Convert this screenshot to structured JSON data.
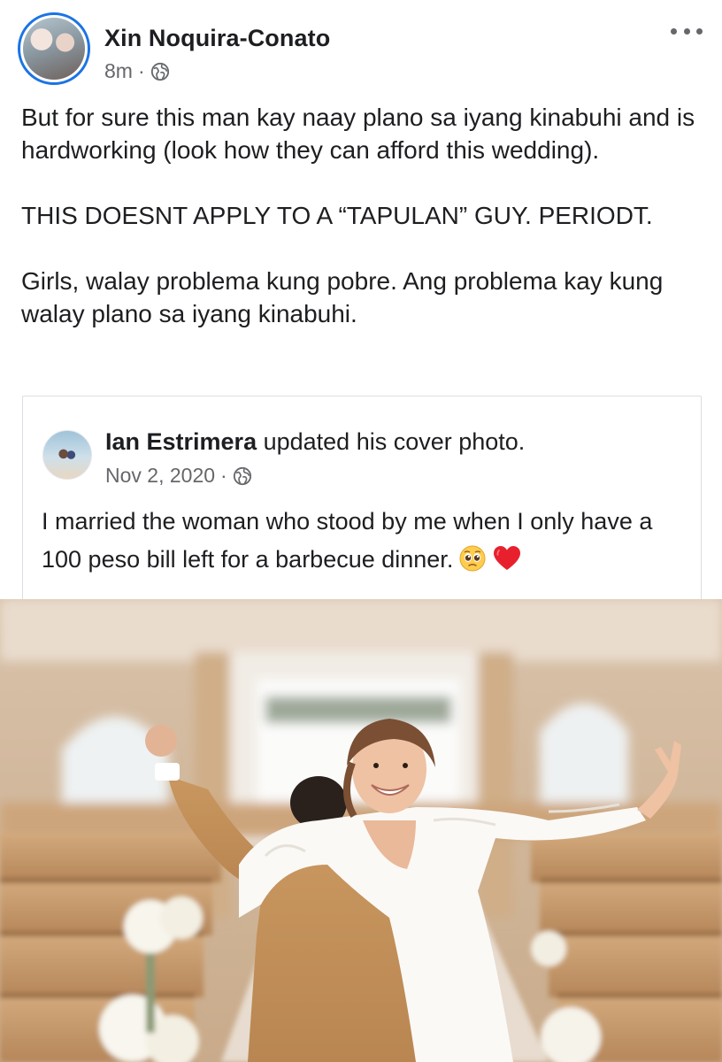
{
  "post": {
    "author": "Xin Noquira-Conato",
    "time": "8m",
    "separator": "·",
    "privacy_icon": "globe-icon",
    "paragraphs": [
      "But for sure this man kay naay plano sa iyang kinabuhi and is hardworking (look how they can afford this wedding).",
      "THIS DOESNT APPLY TO A “TAPULAN” GUY. PERIODT.",
      "Girls, walay problema kung pobre. Ang problema kay kung walay plano sa iyang kinabuhi."
    ]
  },
  "shared": {
    "author": "Ian Estrimera",
    "action": " updated his cover photo.",
    "date": "Nov 2, 2020",
    "separator": "·",
    "privacy_icon": "globe-icon",
    "text": "I married the woman who stood by me when I only have a 100 peso bill left for a barbecue dinner.",
    "emojis": [
      "pleading-face-icon",
      "red-heart-icon"
    ]
  },
  "colors": {
    "story_ring": "#1b74e4",
    "secondary_text": "#65676b",
    "card_border": "#dadde1"
  }
}
